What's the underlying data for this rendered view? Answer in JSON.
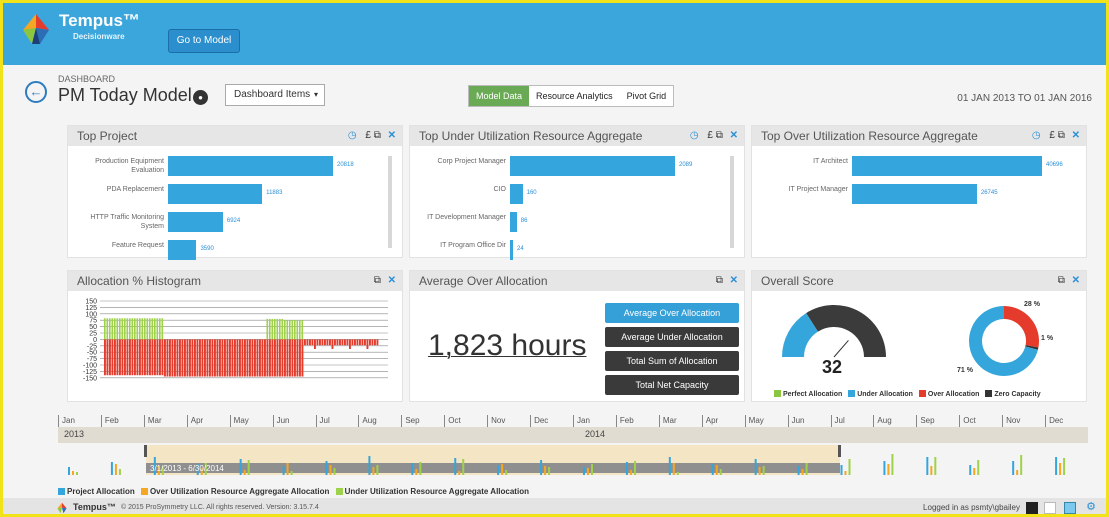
{
  "header": {
    "brand": "Tempus™",
    "brand_sub": "Decisionware",
    "goto_label": "Go to Model"
  },
  "page": {
    "breadcrumb": "DASHBOARD",
    "title": "PM Today Model",
    "dashboard_items": "Dashboard Items",
    "tabs": [
      "Model Data",
      "Resource Analytics",
      "Pivot Grid"
    ],
    "active_tab": "Model Data",
    "date_range": "01 JAN 2013 TO 01 JAN 2016"
  },
  "panels": {
    "top_project": {
      "title": "Top Project",
      "currency": "£",
      "bars": [
        {
          "label": "Production Equipment Evaluation",
          "value": 20818
        },
        {
          "label": "PDA Replacement",
          "value": 11883
        },
        {
          "label": "HTTP Traffic Monitoring System",
          "value": 6924
        },
        {
          "label": "Feature Request",
          "value": 3590
        }
      ]
    },
    "under_util": {
      "title": "Top Under Utilization Resource Aggregate",
      "currency": "£",
      "bars": [
        {
          "label": "Corp Project Manager",
          "value": 2089
        },
        {
          "label": "CIO",
          "value": 160
        },
        {
          "label": "IT Development Manager",
          "value": 86
        },
        {
          "label": "IT Program Office Dir",
          "value": 24
        }
      ]
    },
    "over_util": {
      "title": "Top Over Utilization Resource Aggregate",
      "currency": "£",
      "bars": [
        {
          "label": "IT Architect",
          "value": 40696
        },
        {
          "label": "IT Project Manager",
          "value": 26745
        }
      ]
    },
    "histogram": {
      "title": "Allocation % Histogram",
      "ticks": [
        "150",
        "125",
        "100",
        "75",
        "50",
        "25",
        "0",
        "-25",
        "-50",
        "-75",
        "-100",
        "-125",
        "-150"
      ]
    },
    "avg_over": {
      "title": "Average Over Allocation",
      "value": "1,823",
      "unit": "hours",
      "buttons": [
        "Average Over Allocation",
        "Average Under Allocation",
        "Total Sum of Allocation",
        "Total Net Capacity"
      ]
    },
    "score": {
      "title": "Overall Score",
      "value": "32",
      "gauge_fraction": 0.32,
      "donut": [
        {
          "label": "71 %",
          "value": 71,
          "color": "#35a6dc"
        },
        {
          "label": "28 %",
          "value": 28,
          "color": "#e53b2c"
        },
        {
          "label": "1 %",
          "value": 1,
          "color": "#333333"
        }
      ],
      "legend": [
        "Perfect Allocation",
        "Under Allocation",
        "Over Allocation",
        "Zero Capacity"
      ],
      "legend_colors": [
        "#8cc63f",
        "#35a6dc",
        "#e53b2c",
        "#333333"
      ]
    }
  },
  "timeline": {
    "months": [
      "Jan",
      "Feb",
      "Mar",
      "Apr",
      "May",
      "Jun",
      "Jul",
      "Aug",
      "Sep",
      "Oct",
      "Nov",
      "Dec",
      "Jan",
      "Feb",
      "Mar",
      "Apr",
      "May",
      "Jun",
      "Jul",
      "Aug",
      "Sep",
      "Oct",
      "Nov",
      "Dec"
    ],
    "years": [
      "2013",
      "2014"
    ],
    "range": "3/1/2013 - 6/30/2014",
    "legend": [
      "Project Allocation",
      "Over Utilization Resource Aggregate Allocation",
      "Under Utilization Resource Aggregate Allocation"
    ],
    "legend_colors": [
      "#35a6dc",
      "#f5a623",
      "#9ed24a"
    ]
  },
  "footer": {
    "brand": "Tempus™",
    "copyright": "© 2015 ProSymmetry LLC. All rights reserved. Version: 3.15.7.4",
    "user": "Logged in as psmty\\gbailey"
  }
}
